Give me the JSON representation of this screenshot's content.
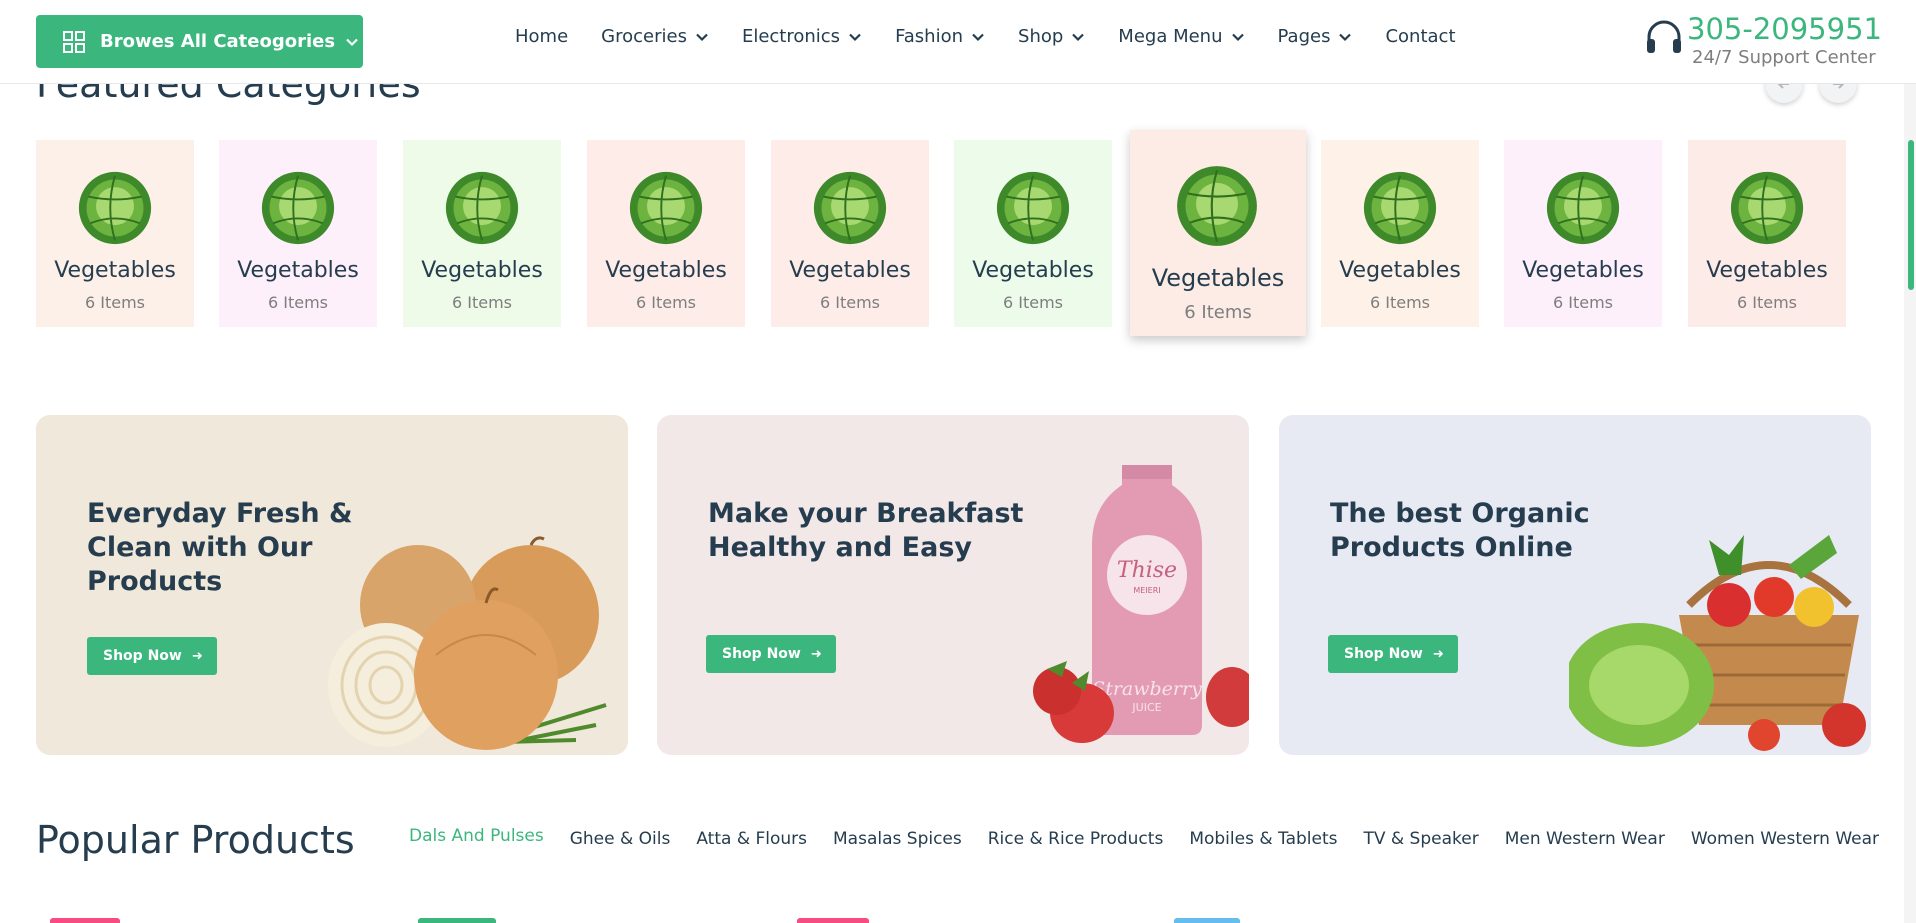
{
  "header": {
    "browse_label": "Browes All Cateogories",
    "nav": [
      {
        "label": "Home",
        "has_dropdown": false
      },
      {
        "label": "Groceries",
        "has_dropdown": true
      },
      {
        "label": "Electronics",
        "has_dropdown": true
      },
      {
        "label": "Fashion",
        "has_dropdown": true
      },
      {
        "label": "Shop",
        "has_dropdown": true
      },
      {
        "label": "Mega Menu",
        "has_dropdown": true
      },
      {
        "label": "Pages",
        "has_dropdown": true
      },
      {
        "label": "Contact",
        "has_dropdown": false
      }
    ],
    "support_phone": "305-2095951",
    "support_text": "24/7 Support Center"
  },
  "featured": {
    "title": "Featured Categories",
    "categories": [
      {
        "name": "Vegetables",
        "count": "6 Items",
        "bg": "#fdf0e8"
      },
      {
        "name": "Vegetables",
        "count": "6 Items",
        "bg": "#fdf0fb"
      },
      {
        "name": "Vegetables",
        "count": "6 Items",
        "bg": "#eefbe8"
      },
      {
        "name": "Vegetables",
        "count": "6 Items",
        "bg": "#fdece8"
      },
      {
        "name": "Vegetables",
        "count": "6 Items",
        "bg": "#fdece8"
      },
      {
        "name": "Vegetables",
        "count": "6 Items",
        "bg": "#ecfbea"
      },
      {
        "name": "Vegetables",
        "count": "6 Items",
        "bg": "#fdece5",
        "active": true
      },
      {
        "name": "Vegetables",
        "count": "6 Items",
        "bg": "#fdf1e8"
      },
      {
        "name": "Vegetables",
        "count": "6 Items",
        "bg": "#fdf0fb"
      },
      {
        "name": "Vegetables",
        "count": "6 Items",
        "bg": "#fdebe8"
      }
    ]
  },
  "banners": [
    {
      "title": "Everyday Fresh &\nClean with Our\nProducts",
      "button": "Shop Now",
      "bg": "#f0e8da",
      "art": "onion"
    },
    {
      "title": "Make your Breakfast\nHealthy and Easy",
      "button": "Shop Now",
      "bg": "#f3e8e8",
      "art": "juice",
      "bottle_text": "Thise",
      "bottle_sub": "MEIERI",
      "bottle_label": "Strawberry",
      "bottle_label2": "JUICE"
    },
    {
      "title": "The best Organic\nProducts Online",
      "button": "Shop Now",
      "bg": "#e7eaf3",
      "art": "basket"
    }
  ],
  "popular": {
    "title": "Popular Products",
    "tabs": [
      "Dals And Pulses",
      "Ghee & Oils",
      "Atta & Flours",
      "Masalas Spices",
      "Rice & Rice Products",
      "Mobiles & Tablets",
      "TV & Speaker",
      "Men Western Wear",
      "Women Western Wear"
    ],
    "active_tab": 0
  },
  "colors": {
    "brand": "#3bb77e",
    "heading": "#253d4e",
    "muted": "#7e7e7e"
  },
  "icons": {
    "browse": "grid-icon",
    "dropdown": "chevron-down-icon",
    "support": "headset-icon",
    "prev": "arrow-left-icon",
    "next": "arrow-right-icon",
    "shop_arrow": "arrow-right-icon"
  }
}
